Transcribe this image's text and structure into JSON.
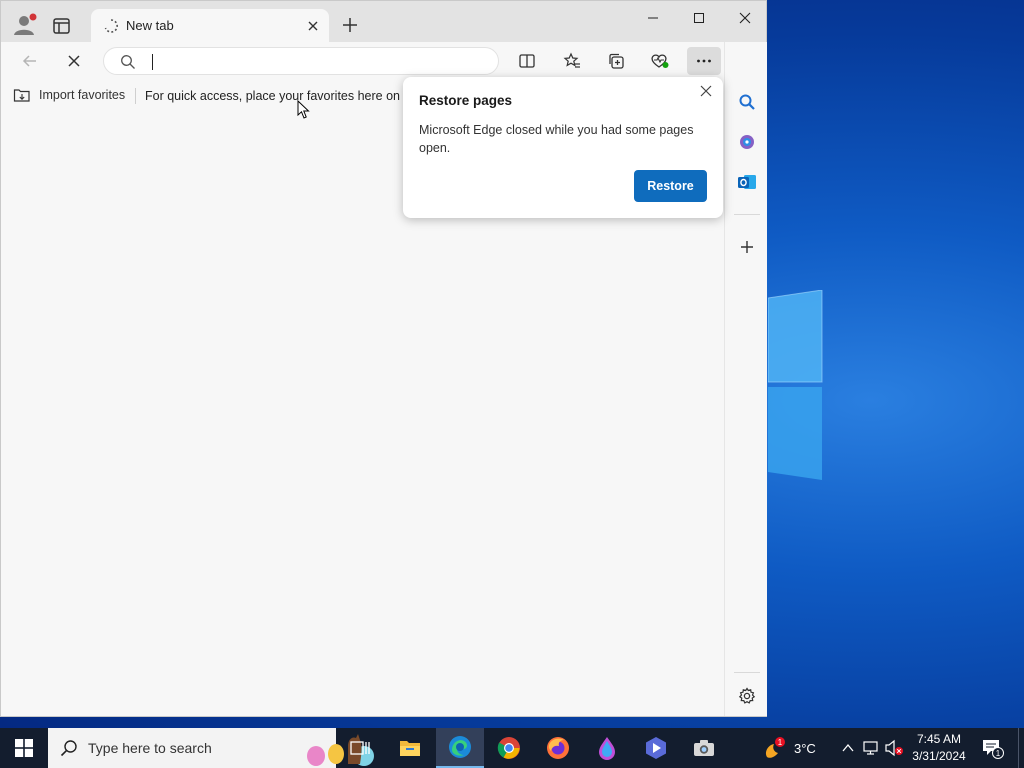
{
  "browser": {
    "tab": {
      "title": "New tab"
    },
    "address": {
      "value": "",
      "placeholder": ""
    },
    "favorites_bar": {
      "import_label": "Import favorites",
      "hint": "For quick access, place your favorites here on the favorites bar."
    }
  },
  "popup": {
    "title": "Restore pages",
    "message": "Microsoft Edge closed while you had some pages open.",
    "button": "Restore"
  },
  "taskbar": {
    "search_placeholder": "Type here to search",
    "apps": [
      "task-view",
      "file-explorer",
      "edge",
      "chrome",
      "firefox",
      "app-drop",
      "app-shield",
      "camera"
    ],
    "weather": {
      "temp": "3°C",
      "badge": "1"
    },
    "clock": {
      "time": "7:45 AM",
      "date": "3/31/2024"
    },
    "notification_count": "1"
  },
  "colors": {
    "accent": "#0f6cbd",
    "taskbar": "#131d2e",
    "desktop": "#0f5bc4"
  }
}
